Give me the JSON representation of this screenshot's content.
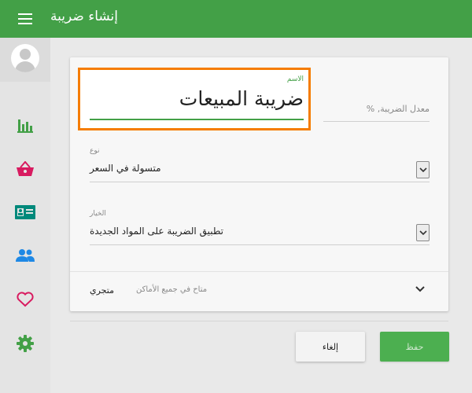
{
  "header": {
    "title": "إنشاء ضريبة",
    "menu_icon": "hamburger-menu-icon",
    "background": "#43a047"
  },
  "sidebar": {
    "items": [
      {
        "icon": "bar-chart-icon",
        "color": "#43a047"
      },
      {
        "icon": "basket-icon",
        "color": "#d81b60"
      },
      {
        "icon": "contact-card-icon",
        "color": "#00897b"
      },
      {
        "icon": "people-icon",
        "color": "#1e88e5"
      },
      {
        "icon": "heart-icon",
        "color": "#d81b60"
      },
      {
        "icon": "gear-icon",
        "color": "#43a047"
      }
    ]
  },
  "form": {
    "name": {
      "label": "الاسم",
      "value": "ضريبة المبيعات"
    },
    "rate": {
      "label": "معدل الضريبة, %",
      "suffix": "%"
    },
    "type": {
      "label": "نوع",
      "value": "متسولة في السعر"
    },
    "option": {
      "label": "الخيار",
      "value": "تطبيق الضريبة على المواد الجديدة"
    },
    "store": {
      "name": "متجري",
      "description": "متاح في جميع الأماكن"
    }
  },
  "actions": {
    "cancel_label": "إلغاء",
    "save_label": "حفظ"
  },
  "colors": {
    "accent": "#43a047",
    "focus_outline": "#f57c00",
    "save_button": "#4caf50"
  }
}
